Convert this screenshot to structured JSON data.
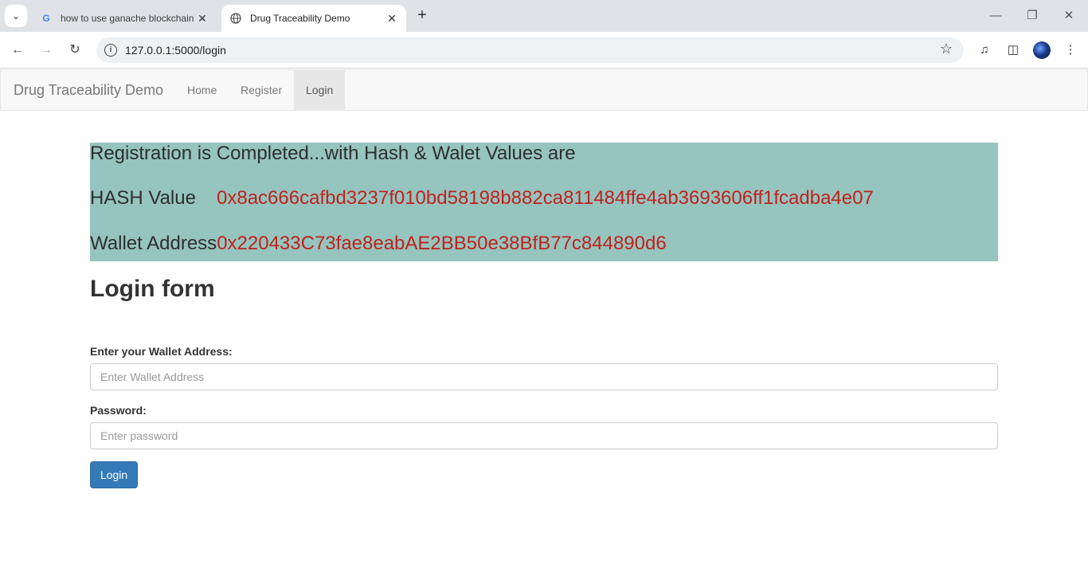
{
  "browser": {
    "tabs": [
      {
        "title": "how to use ganache blockchain",
        "favicon": "google-icon"
      },
      {
        "title": "Drug Traceability Demo",
        "favicon": "globe-icon"
      }
    ],
    "url": "127.0.0.1:5000/login"
  },
  "navbar": {
    "brand": "Drug Traceability Demo",
    "links": [
      "Home",
      "Register",
      "Login"
    ],
    "active": "Login"
  },
  "alert": {
    "message": "Registration is Completed...with Hash & Walet Values are",
    "hash_label": "HASH Value",
    "hash_value": "0x8ac666cafbd3237f010bd58198b882ca811484ffe4ab3693606ff1fcadba4e07",
    "wallet_label": "Wallet Address",
    "wallet_value": "0x220433C73fae8eabAE2BB50e38BfB77c844890d6",
    "background": "#96c4be",
    "value_color": "#c0221d"
  },
  "form": {
    "heading": "Login form",
    "wallet_label": "Enter your Wallet Address:",
    "wallet_placeholder": "Enter Wallet Address",
    "password_label": "Password:",
    "password_placeholder": "Enter password",
    "submit": "Login"
  }
}
